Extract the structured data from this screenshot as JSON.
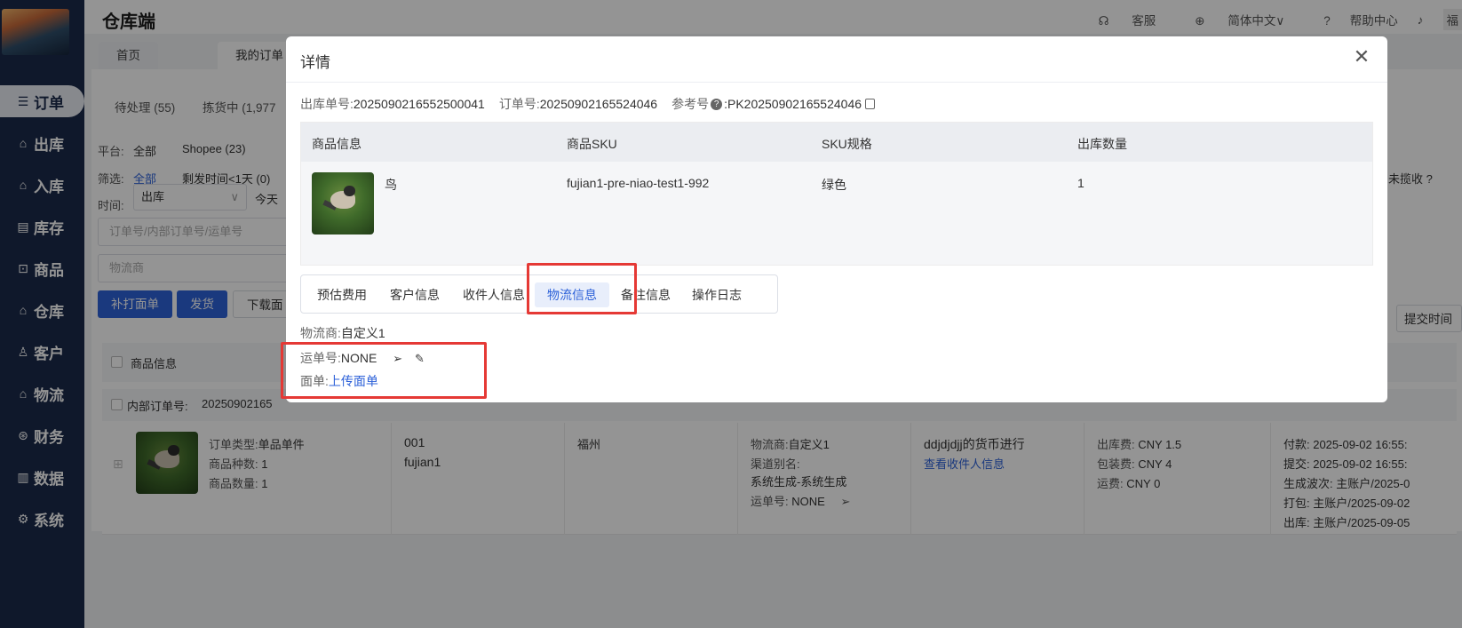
{
  "app": {
    "title": "仓库端"
  },
  "topbar": {
    "service": "客服",
    "language": "简体中文",
    "help": "帮助中心",
    "user_initial": "福"
  },
  "sidebar": {
    "items": [
      {
        "icon": "list-icon",
        "label": "订单"
      },
      {
        "icon": "outbound-icon",
        "label": "出库"
      },
      {
        "icon": "inbound-icon",
        "label": "入库"
      },
      {
        "icon": "inventory-icon",
        "label": "库存"
      },
      {
        "icon": "goods-icon",
        "label": "商品"
      },
      {
        "icon": "warehouse-icon",
        "label": "仓库"
      },
      {
        "icon": "customer-icon",
        "label": "客户"
      },
      {
        "icon": "logistics-icon",
        "label": "物流"
      },
      {
        "icon": "finance-icon",
        "label": "财务"
      },
      {
        "icon": "data-icon",
        "label": "数据"
      },
      {
        "icon": "system-icon",
        "label": "系统"
      }
    ]
  },
  "tabs": {
    "home": "首页",
    "my_orders": "我的订单"
  },
  "background": {
    "status_pending": "待处理 (55)",
    "status_picking": "拣货中 (1,977",
    "platform_label": "平台:",
    "platform_all": "全部",
    "platform_shopee": "Shopee (23)",
    "filter_label": "筛选:",
    "filter_all": "全部",
    "filter_remaining": "剩发时间<1天 (0)",
    "not_collected": "未揽收",
    "time_label": "时间:",
    "time_select": "出库",
    "time_today": "今天",
    "order_input_placeholder": "订单号/内部订单号/运单号",
    "carrier_input_placeholder": "物流商",
    "btn_reprint": "补打面单",
    "btn_ship": "发货",
    "btn_download": "下载面",
    "sort_button": "提交时间↓",
    "col_product_info": "商品信息",
    "inner_order_label": "内部订单号:",
    "inner_order_value": "20250902165",
    "row": {
      "order_type_label": "订单类型:",
      "order_type": "单品单件",
      "kinds_label": "商品种数:",
      "kinds": "1",
      "qty_label": "商品数量:",
      "qty": "1",
      "code": "001",
      "sku_short": "fujian1",
      "city": "福州",
      "carrier_label": "物流商:",
      "carrier": "自定义1",
      "channel_label": "渠道别名:",
      "channel": "系统生成-系统生成",
      "tracking_label": "运单号:",
      "tracking": "NONE",
      "recipient_name": "ddjdjdjj的货币进行",
      "recipient_link": "查看收件人信息",
      "fee_out_label": "出库费:",
      "fee_out": "CNY 1.5",
      "fee_pack_label": "包装费:",
      "fee_pack": "CNY 4",
      "fee_ship_label": "运费:",
      "fee_ship": "CNY 0",
      "t_pay": "付款: 2025-09-02 16:55:",
      "t_submit": "提交: 2025-09-02 16:55:",
      "t_wave": "生成波次: 主账户/2025-0",
      "t_pack": "打包: 主账户/2025-09-02",
      "t_out": "出库: 主账户/2025-09-05"
    }
  },
  "modal": {
    "title": "详情",
    "outbound_no_label": "出库单号:",
    "outbound_no": "2025090216552500041",
    "order_no_label": "订单号:",
    "order_no": "20250902165524046",
    "ref_no_label": "参考号",
    "ref_no": "PK20250902165524046",
    "table": {
      "headers": [
        "商品信息",
        "商品SKU",
        "SKU规格",
        "出库数量"
      ],
      "rows": [
        {
          "name": "鸟",
          "sku": "fujian1-pre-niao-test1-992",
          "spec": "绿色",
          "qty": "1"
        }
      ]
    },
    "detail_tabs": [
      "预估费用",
      "客户信息",
      "收件人信息",
      "物流信息",
      "备注信息",
      "操作日志"
    ],
    "active_tab": "物流信息",
    "carrier_label": "物流商:",
    "carrier": "自定义1",
    "tracking_label": "运单号:",
    "tracking": "NONE",
    "label_label": "面单:",
    "label_upload": "上传面单"
  },
  "colors": {
    "sidebar_bg": "#1b2a4a",
    "accent": "#2e62d9",
    "highlight": "#e53935"
  }
}
